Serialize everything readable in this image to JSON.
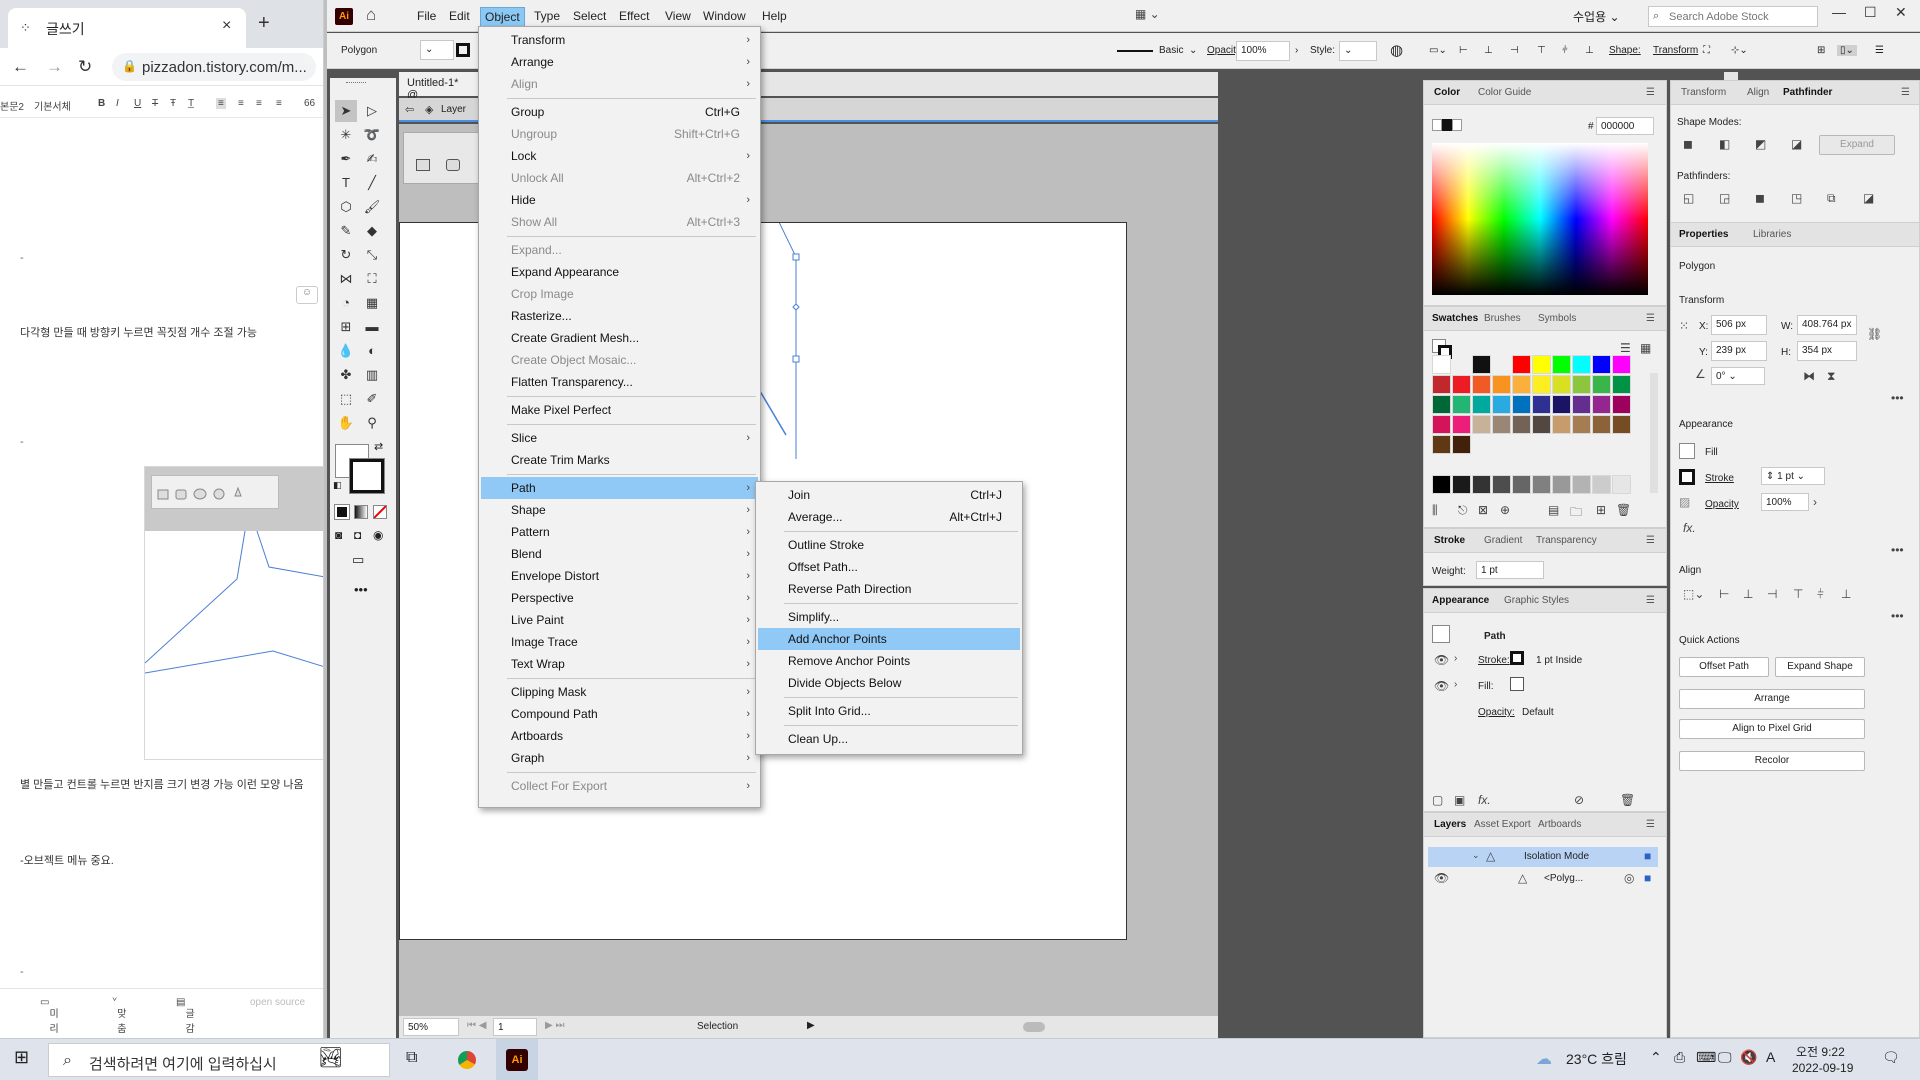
{
  "browser": {
    "tab_title": "글쓰기",
    "tab_close": "×",
    "new_tab": "+",
    "url": "pizzadon.tistory.com/m...",
    "editor_toolbar": {
      "style": "본문2",
      "font": "기본서체",
      "bold": "B",
      "italic": "I",
      "underline": "U",
      "strike": "T",
      "more": "66"
    },
    "dash1": "-",
    "line1": "다각형 만들 때 방향키 누르면 꼭짓점 개수 조절 가능",
    "dash2": "-",
    "line2": "별 만들고 컨트롤 누르면 반지름 크기 변경 가능 이런 모양 나옴",
    "line3": "-오브젝트 메뉴 중요.",
    "dash3": "-",
    "footer": {
      "preview": "미리보기",
      "spellcheck": "맞춤법",
      "word_search": "글감검색",
      "open_source": "open source"
    }
  },
  "illustrator": {
    "logo": "Ai",
    "menus": [
      "File",
      "Edit",
      "Object",
      "Type",
      "Select",
      "Effect",
      "View",
      "Window",
      "Help"
    ],
    "active_menu": "Object",
    "workspace": "수업용",
    "stock_search_placeholder": "Search Adobe Stock",
    "control": {
      "selection_type": "Polygon",
      "stroke_style": "Basic",
      "opacity_label": "Opacity:",
      "opacity_value": "100%",
      "style_label": "Style:",
      "shape_label": "Shape:",
      "transform_label": "Transform"
    },
    "document_tab": "Untitled-1* @",
    "isolation_layer": "Layer",
    "status": {
      "zoom": "50%",
      "artboard": "1",
      "tool": "Selection"
    }
  },
  "object_menu": [
    {
      "label": "Transform",
      "shortcut": "",
      "sub": true,
      "disabled": false
    },
    {
      "label": "Arrange",
      "shortcut": "",
      "sub": true,
      "disabled": false
    },
    {
      "label": "Align",
      "shortcut": "",
      "sub": true,
      "disabled": true
    },
    {
      "sep": true
    },
    {
      "label": "Group",
      "shortcut": "Ctrl+G",
      "sub": false,
      "disabled": false
    },
    {
      "label": "Ungroup",
      "shortcut": "Shift+Ctrl+G",
      "sub": false,
      "disabled": true
    },
    {
      "label": "Lock",
      "shortcut": "",
      "sub": true,
      "disabled": false
    },
    {
      "label": "Unlock All",
      "shortcut": "Alt+Ctrl+2",
      "sub": false,
      "disabled": true
    },
    {
      "label": "Hide",
      "shortcut": "",
      "sub": true,
      "disabled": false
    },
    {
      "label": "Show All",
      "shortcut": "Alt+Ctrl+3",
      "sub": false,
      "disabled": true
    },
    {
      "sep": true
    },
    {
      "label": "Expand...",
      "shortcut": "",
      "sub": false,
      "disabled": true
    },
    {
      "label": "Expand Appearance",
      "shortcut": "",
      "sub": false,
      "disabled": false
    },
    {
      "label": "Crop Image",
      "shortcut": "",
      "sub": false,
      "disabled": true
    },
    {
      "label": "Rasterize...",
      "shortcut": "",
      "sub": false,
      "disabled": false
    },
    {
      "label": "Create Gradient Mesh...",
      "shortcut": "",
      "sub": false,
      "disabled": false
    },
    {
      "label": "Create Object Mosaic...",
      "shortcut": "",
      "sub": false,
      "disabled": true
    },
    {
      "label": "Flatten Transparency...",
      "shortcut": "",
      "sub": false,
      "disabled": false
    },
    {
      "sep": true
    },
    {
      "label": "Make Pixel Perfect",
      "shortcut": "",
      "sub": false,
      "disabled": false
    },
    {
      "sep": true
    },
    {
      "label": "Slice",
      "shortcut": "",
      "sub": true,
      "disabled": false
    },
    {
      "label": "Create Trim Marks",
      "shortcut": "",
      "sub": false,
      "disabled": false
    },
    {
      "sep": true
    },
    {
      "label": "Path",
      "shortcut": "",
      "sub": true,
      "disabled": false,
      "highlight": true
    },
    {
      "label": "Shape",
      "shortcut": "",
      "sub": true,
      "disabled": false
    },
    {
      "label": "Pattern",
      "shortcut": "",
      "sub": true,
      "disabled": false
    },
    {
      "label": "Blend",
      "shortcut": "",
      "sub": true,
      "disabled": false
    },
    {
      "label": "Envelope Distort",
      "shortcut": "",
      "sub": true,
      "disabled": false
    },
    {
      "label": "Perspective",
      "shortcut": "",
      "sub": true,
      "disabled": false
    },
    {
      "label": "Live Paint",
      "shortcut": "",
      "sub": true,
      "disabled": false
    },
    {
      "label": "Image Trace",
      "shortcut": "",
      "sub": true,
      "disabled": false
    },
    {
      "label": "Text Wrap",
      "shortcut": "",
      "sub": true,
      "disabled": false
    },
    {
      "sep": true
    },
    {
      "label": "Clipping Mask",
      "shortcut": "",
      "sub": true,
      "disabled": false
    },
    {
      "label": "Compound Path",
      "shortcut": "",
      "sub": true,
      "disabled": false
    },
    {
      "label": "Artboards",
      "shortcut": "",
      "sub": true,
      "disabled": false
    },
    {
      "label": "Graph",
      "shortcut": "",
      "sub": true,
      "disabled": false
    },
    {
      "sep": true
    },
    {
      "label": "Collect For Export",
      "shortcut": "",
      "sub": true,
      "disabled": true
    }
  ],
  "path_menu": [
    {
      "label": "Join",
      "shortcut": "Ctrl+J"
    },
    {
      "label": "Average...",
      "shortcut": "Alt+Ctrl+J"
    },
    {
      "sep": true
    },
    {
      "label": "Outline Stroke",
      "shortcut": ""
    },
    {
      "label": "Offset Path...",
      "shortcut": ""
    },
    {
      "label": "Reverse Path Direction",
      "shortcut": ""
    },
    {
      "sep": true
    },
    {
      "label": "Simplify...",
      "shortcut": ""
    },
    {
      "label": "Add Anchor Points",
      "shortcut": "",
      "highlight": true
    },
    {
      "label": "Remove Anchor Points",
      "shortcut": ""
    },
    {
      "label": "Divide Objects Below",
      "shortcut": ""
    },
    {
      "sep": true
    },
    {
      "label": "Split Into Grid...",
      "shortcut": ""
    },
    {
      "sep": true
    },
    {
      "label": "Clean Up...",
      "shortcut": ""
    }
  ],
  "color_panel": {
    "tabs": [
      "Color",
      "Color Guide"
    ],
    "hex_label": "#",
    "hex": "000000"
  },
  "swatches_panel": {
    "tabs": [
      "Swatches",
      "Brushes",
      "Symbols"
    ]
  },
  "swatch_colors": [
    "#ff0000",
    "#ffff00",
    "#00ff00",
    "#00ffff",
    "#0000ff",
    "#ff00ff",
    "#c1272d",
    "#ed1c24",
    "#f15a24",
    "#f7931e",
    "#fbb03b",
    "#fcee21",
    "#d9e021",
    "#8cc63f",
    "#39b54a",
    "#009245",
    "#006837",
    "#22b573",
    "#00a99d",
    "#29abe2",
    "#0071bc",
    "#2e3192",
    "#1b1464",
    "#662d91",
    "#93278f",
    "#9e005d",
    "#d4145a",
    "#ed1e79",
    "#c7b299",
    "#998675",
    "#736357",
    "#534741",
    "#c69c6d",
    "#a67c52",
    "#8c6239",
    "#754c24",
    "#603813",
    "#42210b"
  ],
  "stroke_panel": {
    "tabs": [
      "Stroke",
      "Gradient",
      "Transparency"
    ],
    "weight_label": "Weight:",
    "weight": "1 pt"
  },
  "appearance_panel": {
    "tabs": [
      "Appearance",
      "Graphic Styles"
    ],
    "object": "Path",
    "stroke_label": "Stroke:",
    "stroke_value": "1 pt  Inside",
    "fill_label": "Fill:",
    "opacity_label": "Opacity:",
    "opacity_value": "Default"
  },
  "layers_panel": {
    "tabs": [
      "Layers",
      "Asset Export",
      "Artboards"
    ],
    "row1": "Isolation Mode",
    "row2": "<Polyg..."
  },
  "right_panel": {
    "tabs": [
      "Transform",
      "Align",
      "Pathfinder"
    ],
    "shape_modes": "Shape Modes:",
    "expand": "Expand",
    "pathfinders": "Pathfinders:",
    "prop_tabs": [
      "Properties",
      "Libraries"
    ],
    "object_type": "Polygon",
    "transform_title": "Transform",
    "x_label": "X:",
    "x": "506 px",
    "y_label": "Y:",
    "y": "239 px",
    "w_label": "W:",
    "w": "408.764 px",
    "h_label": "H:",
    "h": "354 px",
    "angle": "0°",
    "appearance_title": "Appearance",
    "fill": "Fill",
    "stroke": "Stroke",
    "stroke_weight": "1 pt",
    "opacity": "Opacity",
    "opacity_value": "100%",
    "fx": "fx.",
    "align_title": "Align",
    "quick_actions": "Quick Actions",
    "offset_path": "Offset Path",
    "expand_shape": "Expand Shape",
    "arrange": "Arrange",
    "align_pixel": "Align to Pixel Grid",
    "recolor": "Recolor"
  },
  "taskbar": {
    "search_placeholder": "검색하려면 여기에 입력하십시",
    "weather": "23°C  흐림",
    "time": "오전 9:22",
    "date": "2022-09-19",
    "ime": "A"
  }
}
